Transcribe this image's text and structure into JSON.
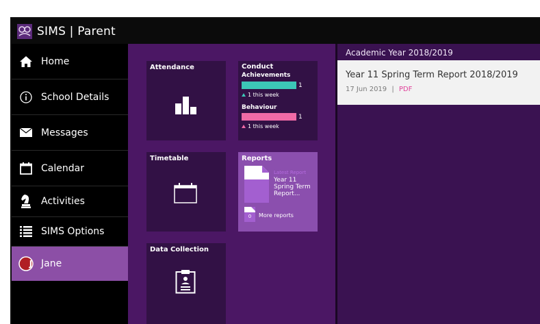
{
  "app": {
    "title": "SIMS | Parent"
  },
  "sidebar": {
    "items": [
      {
        "label": "Home",
        "icon": "home-icon"
      },
      {
        "label": "School Details",
        "icon": "info-icon"
      },
      {
        "label": "Messages",
        "icon": "envelope-icon"
      },
      {
        "label": "Calendar",
        "icon": "calendar-icon"
      },
      {
        "label": "Activities",
        "icon": "chess-piece-icon"
      },
      {
        "label": "SIMS Options",
        "icon": "list-icon"
      },
      {
        "label": "Jane",
        "icon": "avatar-icon",
        "initial": "J",
        "active": true
      }
    ]
  },
  "tiles": {
    "attendance": {
      "title": "Attendance"
    },
    "conduct": {
      "title": "Conduct",
      "achievements": {
        "label": "Achievements",
        "count": "1",
        "week": "1 this week",
        "color": "#3cc7b7"
      },
      "behaviour": {
        "label": "Behaviour",
        "count": "1",
        "week": "1 this week",
        "color": "#f06aa6"
      }
    },
    "timetable": {
      "title": "Timetable"
    },
    "reports": {
      "title": "Reports",
      "latest_label": "Latest Report",
      "latest_name": "Year 11 Spring Term Report...",
      "more_count": "0",
      "more_label": "More reports"
    },
    "data_collection": {
      "title": "Data Collection"
    }
  },
  "right_panel": {
    "year": "Academic Year 2018/2019",
    "report": {
      "title": "Year 11 Spring Term Report 2018/2019",
      "date": "17 Jun 2019",
      "separator": "|",
      "link": "PDF"
    }
  },
  "colors": {
    "topbar": "#0b0b0b",
    "sidebar": "#000000",
    "active": "#8c4fa6",
    "tiles_bg": "#4b1764",
    "tile": "#321145",
    "reports_tile": "#8b4fae",
    "accent_pink": "#e0409a"
  }
}
